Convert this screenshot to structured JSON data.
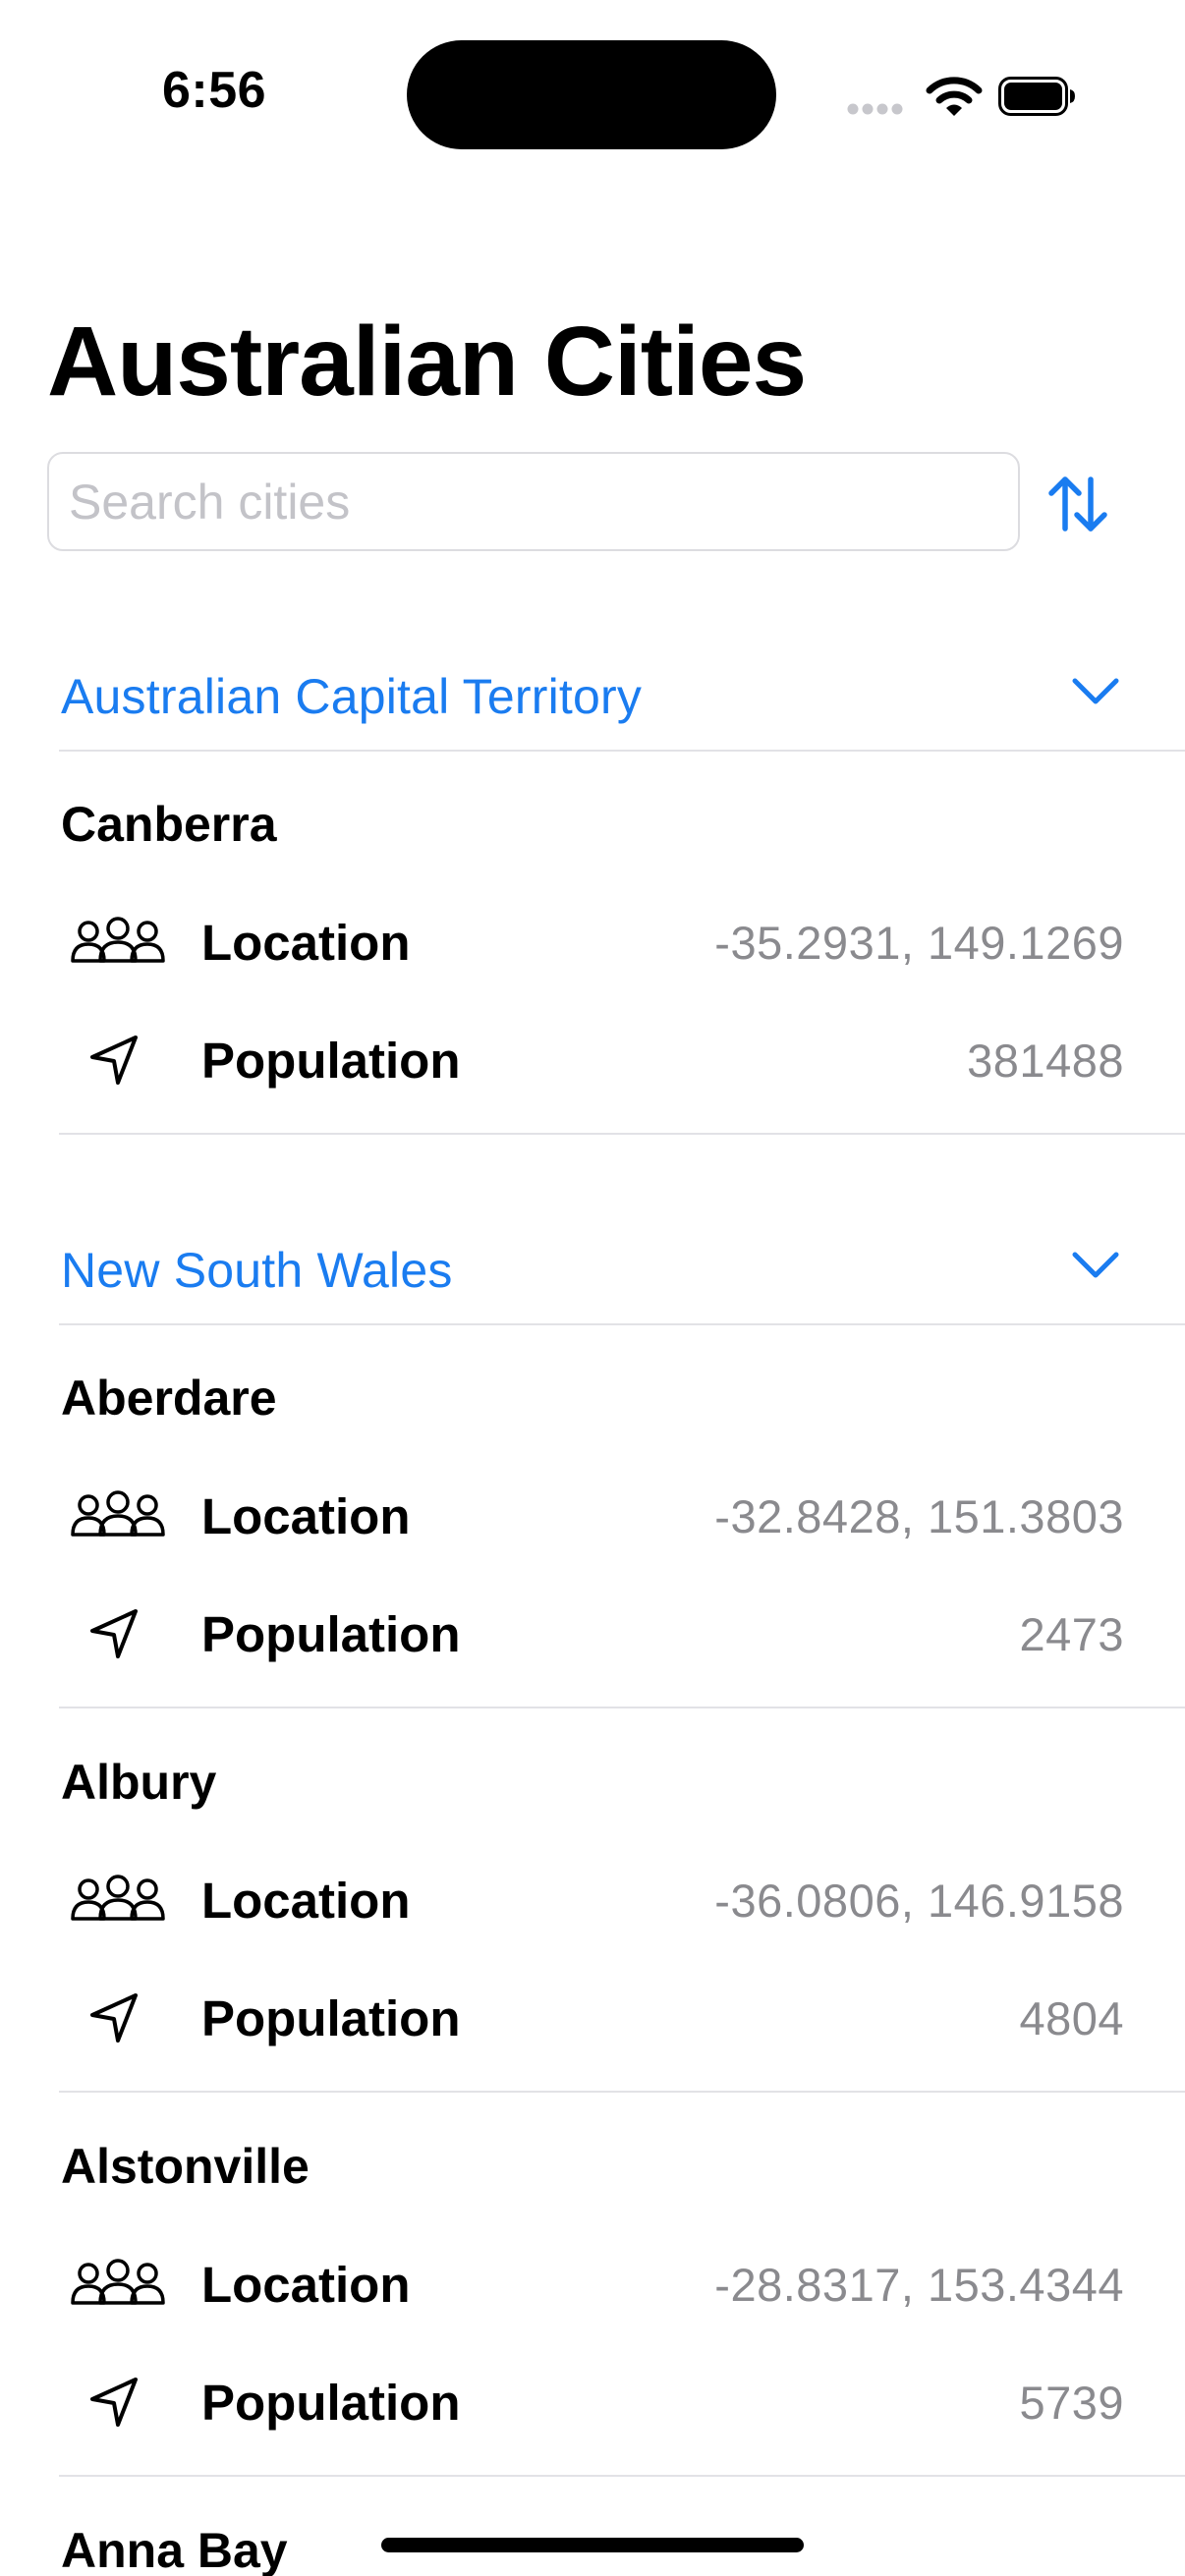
{
  "status_bar": {
    "time": "6:56"
  },
  "header": {
    "title": "Australian Cities"
  },
  "search": {
    "placeholder": "Search cities",
    "value": ""
  },
  "sections": [
    {
      "title": "Australian Capital Territory",
      "cities": [
        {
          "name": "Canberra",
          "location_label": "Location",
          "location": "-35.2931, 149.1269",
          "population_label": "Population",
          "population": "381488"
        }
      ]
    },
    {
      "title": "New South Wales",
      "cities": [
        {
          "name": "Aberdare",
          "location_label": "Location",
          "location": "-32.8428, 151.3803",
          "population_label": "Population",
          "population": "2473"
        },
        {
          "name": "Albury",
          "location_label": "Location",
          "location": "-36.0806, 146.9158",
          "population_label": "Population",
          "population": "4804"
        },
        {
          "name": "Alstonville",
          "location_label": "Location",
          "location": "-28.8317, 153.4344",
          "population_label": "Population",
          "population": "5739"
        },
        {
          "name": "Anna Bay"
        }
      ]
    }
  ],
  "icons": {
    "location_row": "people-icon",
    "population_row": "location-arrow-icon",
    "section_toggle": "chevron-down-icon",
    "sort": "sort-arrows-icon"
  },
  "colors": {
    "accent": "#1a7cf0",
    "secondary_text": "#8a8a8e",
    "divider": "#e2e2e6"
  }
}
